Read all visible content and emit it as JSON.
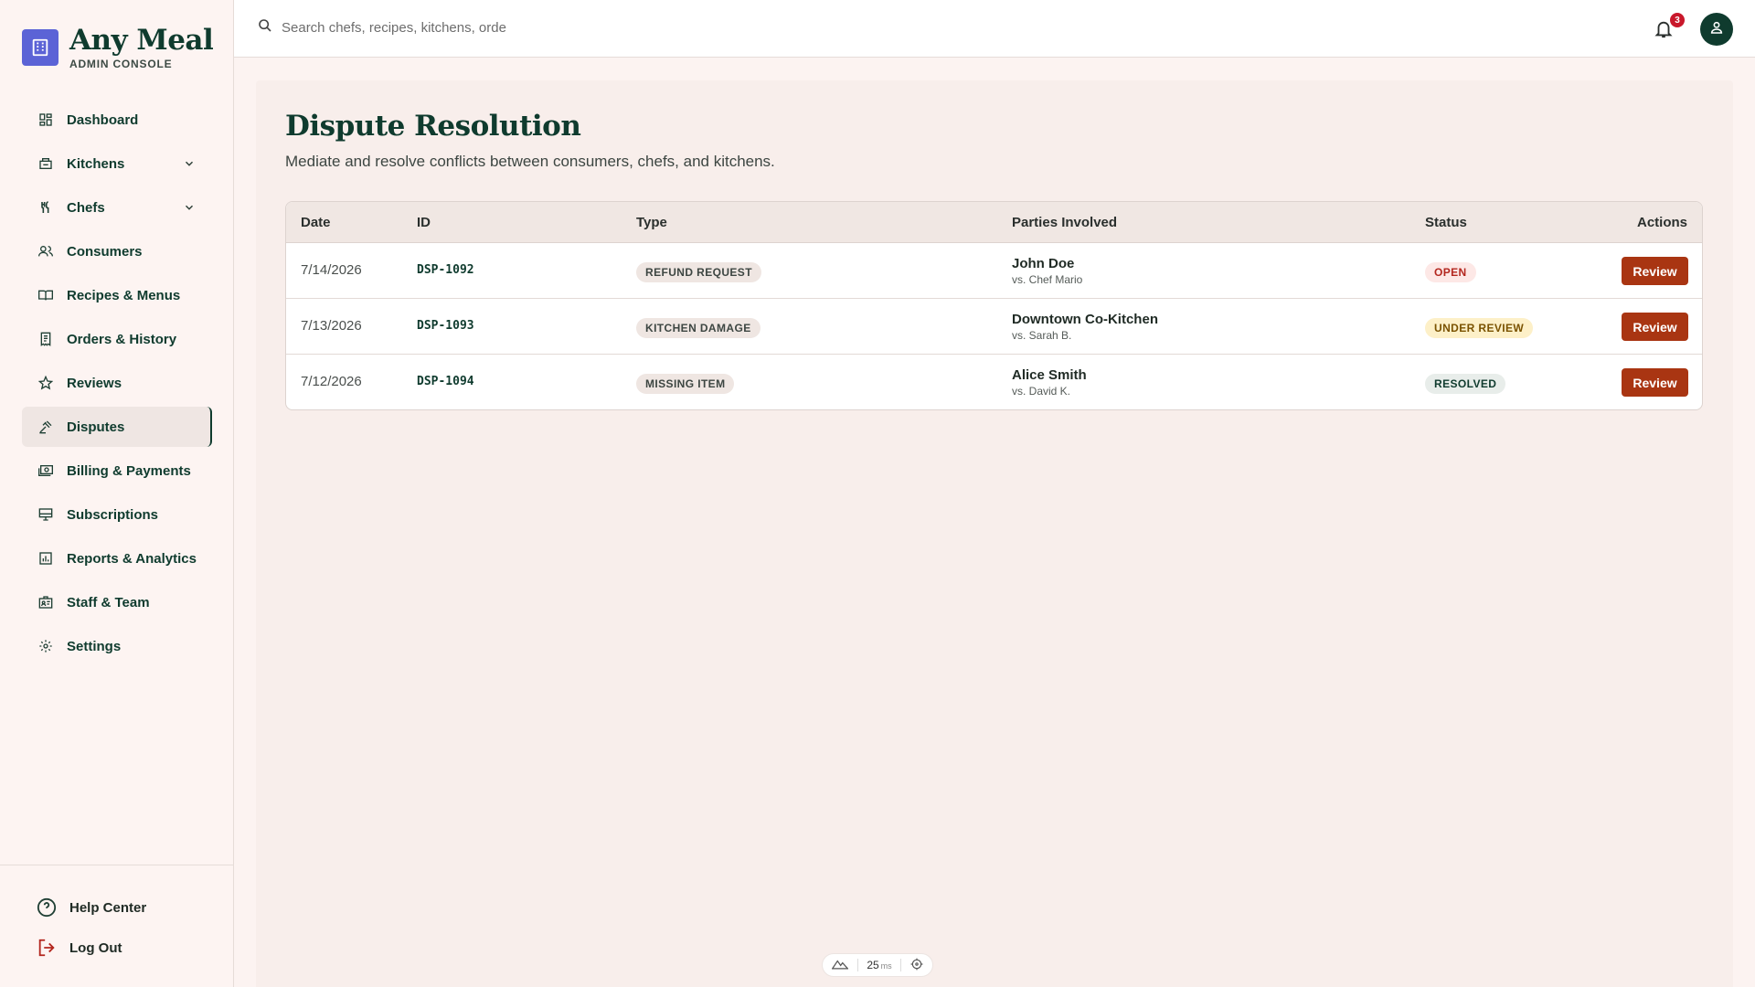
{
  "brand": {
    "name": "Any Meal",
    "subtitle": "ADMIN CONSOLE"
  },
  "nav": {
    "items": [
      {
        "label": "Dashboard",
        "icon": "dashboard-icon"
      },
      {
        "label": "Kitchens",
        "icon": "kitchen-icon",
        "expandable": true
      },
      {
        "label": "Chefs",
        "icon": "utensils-icon",
        "expandable": true
      },
      {
        "label": "Consumers",
        "icon": "users-icon"
      },
      {
        "label": "Recipes & Menus",
        "icon": "book-icon"
      },
      {
        "label": "Orders & History",
        "icon": "receipt-icon"
      },
      {
        "label": "Reviews",
        "icon": "star-icon"
      },
      {
        "label": "Disputes",
        "icon": "gavel-icon",
        "active": true
      },
      {
        "label": "Billing & Payments",
        "icon": "payments-icon"
      },
      {
        "label": "Subscriptions",
        "icon": "subscriptions-icon"
      },
      {
        "label": "Reports & Analytics",
        "icon": "analytics-icon"
      },
      {
        "label": "Staff & Team",
        "icon": "badge-icon"
      },
      {
        "label": "Settings",
        "icon": "gear-icon"
      }
    ],
    "help": "Help Center",
    "logout": "Log Out"
  },
  "topbar": {
    "search_placeholder": "Search chefs, recipes, kitchens, orde",
    "notification_count": "3"
  },
  "page": {
    "title": "Dispute Resolution",
    "subtitle": "Mediate and resolve conflicts between consumers, chefs, and kitchens."
  },
  "table": {
    "headers": {
      "date": "Date",
      "id": "ID",
      "type": "Type",
      "parties": "Parties Involved",
      "status": "Status",
      "actions": "Actions"
    },
    "rows": [
      {
        "date": "7/14/2026",
        "id": "DSP-1092",
        "type": "REFUND REQUEST",
        "party": "John Doe",
        "vs": "vs. Chef Mario",
        "status": "OPEN",
        "action": "Review"
      },
      {
        "date": "7/13/2026",
        "id": "DSP-1093",
        "type": "KITCHEN DAMAGE",
        "party": "Downtown Co-Kitchen",
        "vs": "vs. Sarah B.",
        "status": "UNDER REVIEW",
        "action": "Review"
      },
      {
        "date": "7/12/2026",
        "id": "DSP-1094",
        "type": "MISSING ITEM",
        "party": "Alice Smith",
        "vs": "vs. David K.",
        "status": "RESOLVED",
        "action": "Review"
      }
    ]
  },
  "dev": {
    "value": "25",
    "unit": "ms"
  },
  "colors": {
    "primary": "#0f3b2e",
    "action": "#a93512",
    "brand_logo": "#5b63d6",
    "badge": "#c9182b"
  }
}
